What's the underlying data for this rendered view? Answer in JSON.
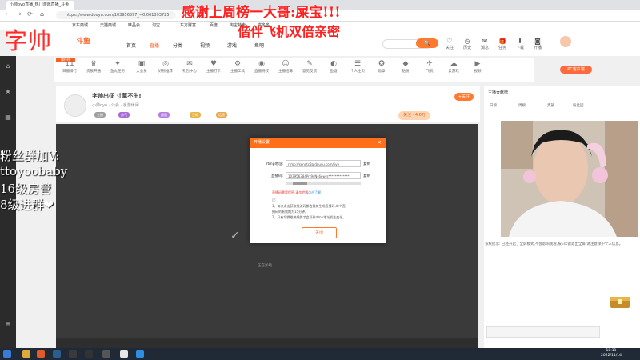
{
  "browser": {
    "tab_title": "小帅oyo直播_热门游戏直播_斗鱼",
    "url": "https://www.douyu.com/103956397_=0.061393725",
    "bookmarks": [
      "京东商城",
      "天猫商城",
      "唯品会",
      "淘宝",
      "东方财富",
      "百度",
      "淘宝特卖",
      "拼多多"
    ]
  },
  "site": {
    "logo": "斗鱼",
    "nav": [
      "首页",
      "直播",
      "分类",
      "视频",
      "游戏",
      "鱼吧"
    ],
    "search_button": "🔍",
    "header_icons": [
      "关注",
      "历史",
      "消息",
      "任务",
      "下载",
      "开播"
    ],
    "pc_button": "PC客户端",
    "category_badge": "排行榜"
  },
  "categories": [
    {
      "icon": "11",
      "label": "日播排行"
    },
    {
      "icon": "♛",
      "label": "贵族开通"
    },
    {
      "icon": "✦",
      "label": "鱼丸任务"
    },
    {
      "icon": "▣",
      "label": "大会员"
    },
    {
      "icon": "◎",
      "label": "好物推荐"
    },
    {
      "icon": "✉",
      "label": "礼包中心"
    },
    {
      "icon": "♥",
      "label": "主播打卡"
    },
    {
      "icon": "⚙",
      "label": "主播工具"
    },
    {
      "icon": "◉",
      "label": "直播特权"
    },
    {
      "icon": "☺",
      "label": "主播招募"
    },
    {
      "icon": "✎",
      "label": "意见反馈"
    },
    {
      "icon": "◐",
      "label": "鱼塘"
    },
    {
      "icon": "☰",
      "label": "个人主页"
    },
    {
      "icon": "✪",
      "label": "勋章"
    },
    {
      "icon": "◆",
      "label": "钻粉"
    },
    {
      "icon": "✈",
      "label": "飞机"
    },
    {
      "icon": "☁",
      "label": "云游戏"
    },
    {
      "icon": "▶",
      "label": "视频"
    }
  ],
  "room": {
    "title": "字帅出征 寸草不生!",
    "sub": "小帅oyo · 公会 · 手游休闲",
    "tags": [
      "主播",
      "帅气",
      "颜值",
      "互动",
      "话痨"
    ],
    "follow": "关注 · 4.6万",
    "follow2": "+关注"
  },
  "dialog": {
    "title": "开播设置",
    "close": "×",
    "rtmp_label": "rtmp地址:",
    "rtmp_value": "rtmp://sendtc3a.douyu.com/live",
    "key_label": "直播码:",
    "key_value": "103956384Prt9vNs6ewrs*************",
    "copy": "复制",
    "warning": "直播码需要保密,请勿泄露",
    "link": "点击了解",
    "notes": [
      "注:",
      "1、每次点击获取推流码都会重新生成直播码,每个直",
      "播码的有效期为15分钟。",
      "2、只有切换推流线路才会导致rtmp地址发生变化。"
    ],
    "ok": "关闭"
  },
  "player": {
    "status": "正在加载..."
  },
  "right_panel": {
    "rank_head": "主播贡献榜",
    "tabs": [
      "日榜",
      "周榜",
      "贵族",
      "粉丝团"
    ],
    "chat_msg": "系统提示: 已经开启了全屏模式,不会影响观看,按Esc键退出全屏,请注意保护个人信息。"
  },
  "overlays": {
    "name": "字帅",
    "thanks": "感谢上周榜一大哥:屎宝!!!",
    "double": "偕伴飞机双倍亲密",
    "left_lines": [
      "粉丝群加V:",
      "ttoyoobaby",
      "16级房管",
      "8级进群❤"
    ]
  },
  "taskbar": {
    "time": "18:11",
    "date": "2022/11/14"
  }
}
